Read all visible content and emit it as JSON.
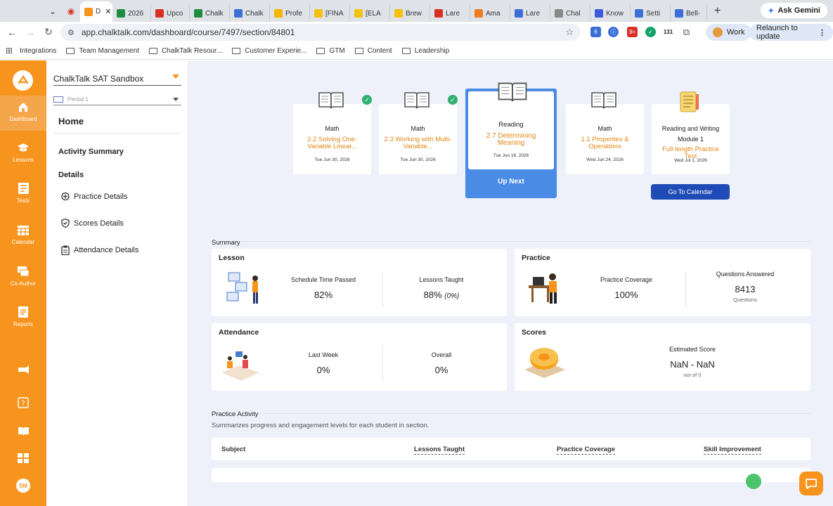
{
  "browser": {
    "tabs": [
      {
        "label": "D",
        "color": "#f7941d",
        "active": true
      },
      {
        "label": "2026",
        "color": "#1e8e3e"
      },
      {
        "label": "Upco",
        "color": "#d93025"
      },
      {
        "label": "Chalk",
        "color": "#1e8e3e"
      },
      {
        "label": "Chalk",
        "color": "#3b6fd8"
      },
      {
        "label": "Profe",
        "color": "#f4b400"
      },
      {
        "label": "[FINA",
        "color": "#f4c20d"
      },
      {
        "label": "[ELA",
        "color": "#f4c20d"
      },
      {
        "label": "Brew",
        "color": "#f4c20d"
      },
      {
        "label": "Lare",
        "color": "#d93025"
      },
      {
        "label": "Ama",
        "color": "#f07b22"
      },
      {
        "label": "Lare",
        "color": "#3b6fd8"
      },
      {
        "label": "Chal",
        "color": "#888888"
      },
      {
        "label": "Know",
        "color": "#3b5bd8"
      },
      {
        "label": "Setti",
        "color": "#3b6fd8"
      },
      {
        "label": "Bell-",
        "color": "#3b6fd8"
      }
    ],
    "ask_gemini": "Ask Gemini",
    "url": "app.chalktalk.com/dashboard/course/7497/section/84801",
    "work_label": "Work",
    "relaunch_label": "Relaunch to update",
    "ext_badge_1": "6",
    "ext_badge_2": "9+",
    "ext_badge_3": "131",
    "bookmarks": [
      "Integrations",
      "Team Management",
      "ChalkTalk Resour...",
      "Customer Experie...",
      "GTM",
      "Content",
      "Leadership"
    ]
  },
  "rail": {
    "items": [
      {
        "label": "Dashboard",
        "icon": "home-icon"
      },
      {
        "label": "Lessons",
        "icon": "graduation-cap-icon"
      },
      {
        "label": "Tests",
        "icon": "test-icon"
      },
      {
        "label": "Calendar",
        "icon": "calendar-icon"
      },
      {
        "label": "Co-Author",
        "icon": "co-author-icon"
      },
      {
        "label": "Reports",
        "icon": "reports-icon"
      }
    ],
    "avatar": "SM",
    "accent": "#f7941d"
  },
  "sidebar": {
    "course": "ChalkTalk SAT Sandbox",
    "period_placeholder": "Period 1",
    "home": "Home",
    "activity_summary": "Activity Summary",
    "details": "Details",
    "links": [
      "Practice Details",
      "Scores Details",
      "Attendance Details"
    ]
  },
  "lessons": [
    {
      "subject": "Math",
      "title": "2.2 Solving One-Variable Linear...",
      "date": "Tue Jun 30, 2026",
      "done": true
    },
    {
      "subject": "Math",
      "title": "2.3 Working with Multi-Variable...",
      "date": "Tue Jun 30, 2026",
      "done": true
    },
    {
      "subject": "Reading",
      "title": "2.7 Determining Meaning",
      "date": "Tue Jun 16, 2026",
      "up_next": true
    },
    {
      "subject": "Math",
      "title": "1.1 Properties & Operations",
      "date": "Wed Jun 24, 2026"
    },
    {
      "subject": "Reading and Writing Module 1",
      "title": "Full length Practice Test",
      "date": "Wed Jul 1, 2026"
    }
  ],
  "up_next_label": "Up Next",
  "calendar_button": "Go To Calendar",
  "summary": {
    "label": "Summary",
    "lesson": {
      "title": "Lesson",
      "schedule_label": "Schedule Time Passed",
      "schedule_value": "82%",
      "taught_label": "Lessons Taught",
      "taught_value": "88%",
      "taught_extra": "(0%)"
    },
    "practice": {
      "title": "Practice",
      "coverage_label": "Practice Coverage",
      "coverage_value": "100%",
      "answered_label": "Questions Answered",
      "answered_value": "8413",
      "answered_unit": "Questions"
    },
    "attendance": {
      "title": "Attendance",
      "week_label": "Last Week",
      "week_value": "0%",
      "overall_label": "Overall",
      "overall_value": "0%"
    },
    "scores": {
      "title": "Scores",
      "est_label": "Estimated Score",
      "est_value": "NaN - NaN",
      "est_sub": "out of 0"
    }
  },
  "practice_activity": {
    "label": "Practice Activity",
    "subtitle": "Summarizes progress and engagement levels for each student in section.",
    "columns": [
      "Subject",
      "Lessons Taught",
      "Practice Coverage",
      "Skill Improvement"
    ]
  }
}
